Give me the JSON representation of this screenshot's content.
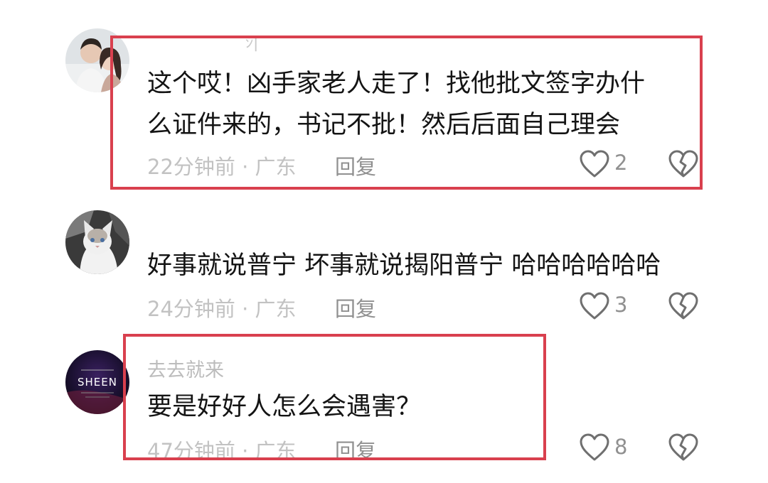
{
  "comments": [
    {
      "text_lines": [
        "这个哎！凶手家老人走了！找他批文签字办什",
        "么证件来的，书记不批！然后后面自己理会"
      ],
      "meta": "22分钟前 · 广东",
      "reply": "回复",
      "likes": "2",
      "avatar": "couple-photo"
    },
    {
      "text": "好事就说普宁 坏事就说揭阳普宁 哈哈哈哈哈哈",
      "meta": "24分钟前 · 广东",
      "reply": "回复",
      "likes": "3",
      "avatar": "cat-photo"
    },
    {
      "username": "去去就来",
      "text": "要是好好人怎么会遇害？",
      "meta": "47分钟前 · 广东",
      "reply": "回复",
      "likes": "8",
      "avatar": "sheen-logo",
      "avatar_text": "SHEEN"
    }
  ],
  "colors": {
    "highlight": "#d9404e",
    "text": "#141414",
    "meta": "#c2c2c2"
  },
  "icons": {
    "like": "heart-outline-icon",
    "dislike": "broken-heart-icon"
  }
}
